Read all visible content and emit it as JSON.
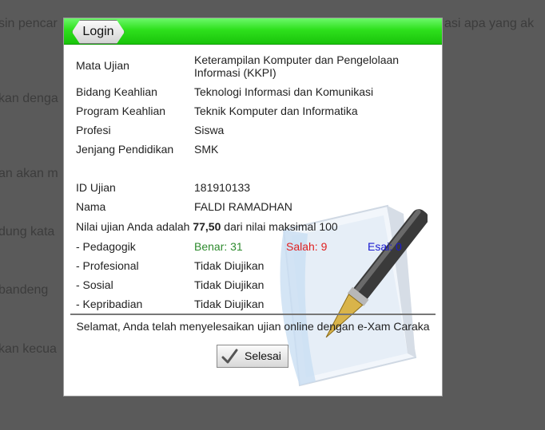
{
  "background": {
    "lines": [
      "sin pencar",
      "asi apa yang ak",
      "kan denga",
      "an akan m",
      "dung kata",
      "bandeng",
      "kan kecua"
    ]
  },
  "dialog": {
    "tab_label": "Login",
    "fields": [
      {
        "label": "Mata Ujian",
        "value": "Keterampilan Komputer dan Pengelolaan Informasi (KKPI)"
      },
      {
        "label": "Bidang Keahlian",
        "value": "Teknologi Informasi dan Komunikasi"
      },
      {
        "label": "Program Keahlian",
        "value": "Teknik Komputer dan Informatika"
      },
      {
        "label": "Profesi",
        "value": "Siswa"
      },
      {
        "label": "Jenjang Pendidikan",
        "value": "SMK"
      }
    ],
    "id_label": "ID Ujian",
    "id_value": "181910133",
    "name_label": "Nama",
    "name_value": "FALDI RAMADHAN",
    "score": {
      "prefix": "Nilai ujian Anda adalah",
      "value": "77,50",
      "suffix": "dari nilai maksimal 100"
    },
    "pedagogik": {
      "label": "- Pedagogik",
      "benar": "Benar: 31",
      "salah": "Salah: 9",
      "esai": "Esai: 0"
    },
    "others": [
      {
        "label": "- Profesional",
        "value": "Tidak Diujikan"
      },
      {
        "label": "- Sosial",
        "value": "Tidak Diujikan"
      },
      {
        "label": "- Kepribadian",
        "value": "Tidak Diujikan"
      }
    ],
    "footer_message": "Selamat, Anda telah menyelesaikan ujian online dengan e-Xam Caraka",
    "button_label": "Selesai"
  },
  "colors": {
    "title_green": "#2ee01c",
    "benar": "#2e8b2e",
    "salah": "#e02020",
    "esai": "#1a1ad0"
  }
}
